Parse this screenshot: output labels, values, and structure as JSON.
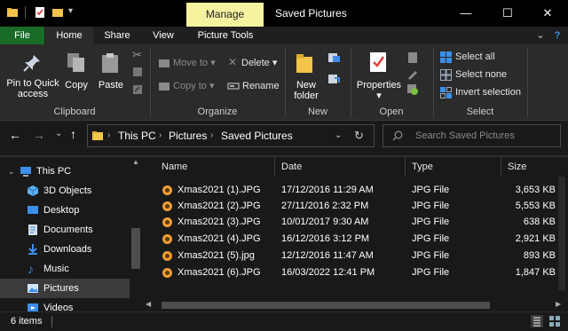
{
  "window": {
    "title": "Saved Pictures",
    "contextual_tab": "Manage",
    "minimize_glyph": "—",
    "maximize_glyph": "☐",
    "close_glyph": "✕"
  },
  "ribbon_tabs": {
    "file": "File",
    "home": "Home",
    "share": "Share",
    "view": "View",
    "picture_tools": "Picture Tools",
    "collapse_glyph": "⌄",
    "help_glyph": "?"
  },
  "ribbon": {
    "clipboard": {
      "label": "Clipboard",
      "pin_line1": "Pin to Quick",
      "pin_line2": "access",
      "copy": "Copy",
      "paste": "Paste"
    },
    "organize": {
      "label": "Organize",
      "move_to": "Move to",
      "copy_to": "Copy to",
      "delete": "Delete",
      "rename": "Rename"
    },
    "new": {
      "label": "New",
      "new_folder_line1": "New",
      "new_folder_line2": "folder"
    },
    "open": {
      "label": "Open",
      "properties": "Properties"
    },
    "select": {
      "label": "Select",
      "select_all": "Select all",
      "select_none": "Select none",
      "invert_selection": "Invert selection"
    }
  },
  "address": {
    "crumbs": [
      "This PC",
      "Pictures",
      "Saved Pictures"
    ],
    "separator": "›",
    "dropdown_glyph": "⌄",
    "search_placeholder": "Search Saved Pictures"
  },
  "nav_pane": {
    "items": [
      {
        "label": "This PC",
        "icon": "pc-icon"
      },
      {
        "label": "3D Objects",
        "icon": "cube-icon"
      },
      {
        "label": "Desktop",
        "icon": "desktop-icon"
      },
      {
        "label": "Documents",
        "icon": "document-icon"
      },
      {
        "label": "Downloads",
        "icon": "download-icon"
      },
      {
        "label": "Music",
        "icon": "music-icon"
      },
      {
        "label": "Pictures",
        "icon": "pictures-icon"
      },
      {
        "label": "Videos",
        "icon": "video-icon"
      }
    ]
  },
  "file_list": {
    "columns": {
      "name": "Name",
      "date": "Date",
      "type": "Type",
      "size": "Size"
    },
    "files": [
      {
        "name": "Xmas2021 (1).JPG",
        "date": "17/12/2016 11:29 AM",
        "type": "JPG File",
        "size": "3,653 KB"
      },
      {
        "name": "Xmas2021 (2).JPG",
        "date": "27/11/2016 2:32 PM",
        "type": "JPG File",
        "size": "5,553 KB"
      },
      {
        "name": "Xmas2021 (3).JPG",
        "date": "10/01/2017 9:30 AM",
        "type": "JPG File",
        "size": "638 KB"
      },
      {
        "name": "Xmas2021 (4).JPG",
        "date": "16/12/2016 3:12 PM",
        "type": "JPG File",
        "size": "2,921 KB"
      },
      {
        "name": "Xmas2021 (5).jpg",
        "date": "12/12/2016 11:47 AM",
        "type": "JPG File",
        "size": "893 KB"
      },
      {
        "name": "Xmas2021 (6).JPG",
        "date": "16/03/2022 12:41 PM",
        "type": "JPG File",
        "size": "1,847 KB"
      }
    ]
  },
  "status": {
    "item_count": "6 items"
  },
  "colors": {
    "manage_tab": "#f6f3a0",
    "file_tab": "#1a6b28",
    "folder": "#f3c54b",
    "accent_blue": "#3c8ee8"
  }
}
